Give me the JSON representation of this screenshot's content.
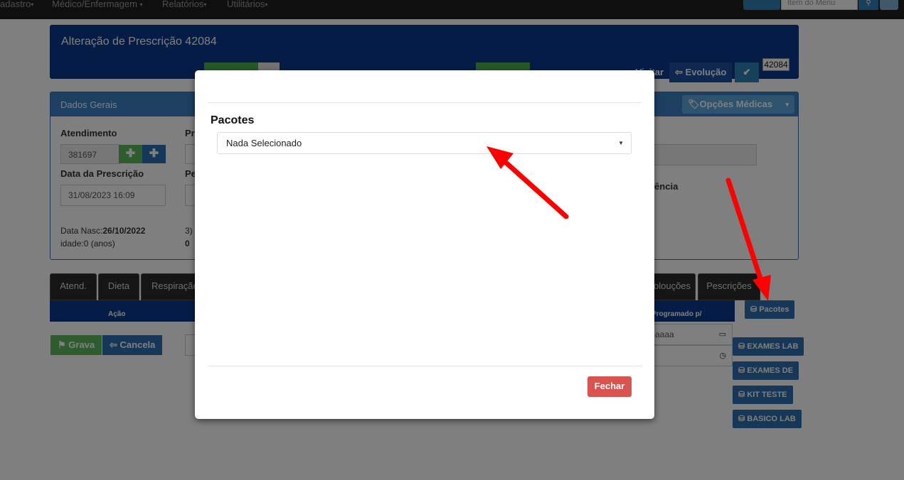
{
  "navbar": {
    "items": [
      {
        "label": "adastro"
      },
      {
        "label": "Médico/Enfermagem"
      },
      {
        "label": "Relatórios"
      },
      {
        "label": "Utilitários"
      }
    ],
    "search_placeholder": "Item do Menu"
  },
  "header": {
    "title": "Alteração de Prescrição 42084",
    "evolucao_label": "Evolução",
    "visitar_label": "Visitar",
    "badge": "42084"
  },
  "main_panel": {
    "heading": "Dados Gerais",
    "options_label": "Opções Médicas",
    "atendimento_label": "Atendimento",
    "atendimento_value": "381697",
    "data_prescricao_label": "Data da Prescrição",
    "data_prescricao_value": "31/08/2023 16:09",
    "data_nasc_prefix": "Data Nasc:",
    "data_nasc_value": "26/10/2022",
    "idade": "idade:0 (anos)",
    "partial_pr": "Pr",
    "partial_pe": "Pe",
    "partial_3": "3)",
    "partial_0": "0",
    "partial_rencia": "rência"
  },
  "tabs": [
    {
      "label": "Atend."
    },
    {
      "label": "Dieta"
    },
    {
      "label": "Respiração"
    },
    {
      "label": "olouções"
    },
    {
      "label": "Pescrições"
    }
  ],
  "table": {
    "col_acao": "Ação",
    "col_programado": "Programado p/",
    "date_placeholder": "aaaa"
  },
  "actions": {
    "grava": "Grava",
    "cancela": "Cancela"
  },
  "side_buttons": [
    {
      "label": "Pacotes"
    },
    {
      "label": "EXAMES LAB"
    },
    {
      "label": "EXAMES DE"
    },
    {
      "label": "KIT TESTE"
    },
    {
      "label": "BASICO LAB"
    }
  ],
  "modal": {
    "label": "Pacotes",
    "select_value": "Nada Selecionado",
    "close_label": "Fechar"
  },
  "colors": {
    "header_blue": "#0a3b8c",
    "panel_blue": "#3a7fc4",
    "danger": "#d9534f",
    "annotation_red": "#ff0000"
  }
}
